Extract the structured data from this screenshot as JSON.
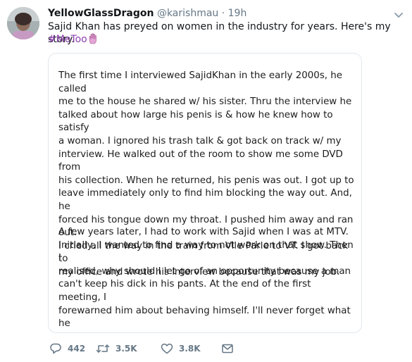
{
  "user": {
    "display_name": "YellowGlassDragon",
    "handle": "@karishmau",
    "separator": "·",
    "time": "19h",
    "avatar_icon": "avatar-photo"
  },
  "tweet": {
    "text": "Sajid Khan has preyed on women in the industry for years. Here's my story.",
    "hashtag": "#MeToo",
    "hashtag_emoji": "raised-hand-icon"
  },
  "media": {
    "paragraph_1": "The first time I interviewed SajidKhan in the early 2000s, he called\nme to the house he shared w/ his sister. Thru the interview he\ntalked about how large his penis is & how he knew how to satisfy\na woman. I ignored his trash talk & got back on track w/ my\ninterview. He walked out of the room to show me some DVD from\nhis collection. When he returned, his penis was out. I got up to\nleave immediately only to find him blocking the way out. And, he\nforced his tongue down my throat. I pushed him away and ran out.\nI cried all the way in the train from Vile Parle to VT. I got back to\nmy office and wrote his interview because that was my job.",
    "paragraph_2": "A few years later, I had to work with Sajid when I was at MTV.\nInitially, I wanted to find a way to not work on that show. Then I\nrealised, why should I let go of an opportunity because a man\ncan't keep his dick in his pants. At the end of the first meeting, I\nforewarned him about behaving himself. I'll never forget what he\nsaid to me \"You are fatter than you used to be. I won't touch you\nwith a barge pole.\" And then he laughed."
  },
  "actions": {
    "replies": "442",
    "retweets": "3.5K",
    "likes": "3.8K"
  },
  "colors": {
    "text": "#14171a",
    "muted": "#657786",
    "border": "#e1e8ed",
    "hashtag": "#8e3fb0"
  }
}
